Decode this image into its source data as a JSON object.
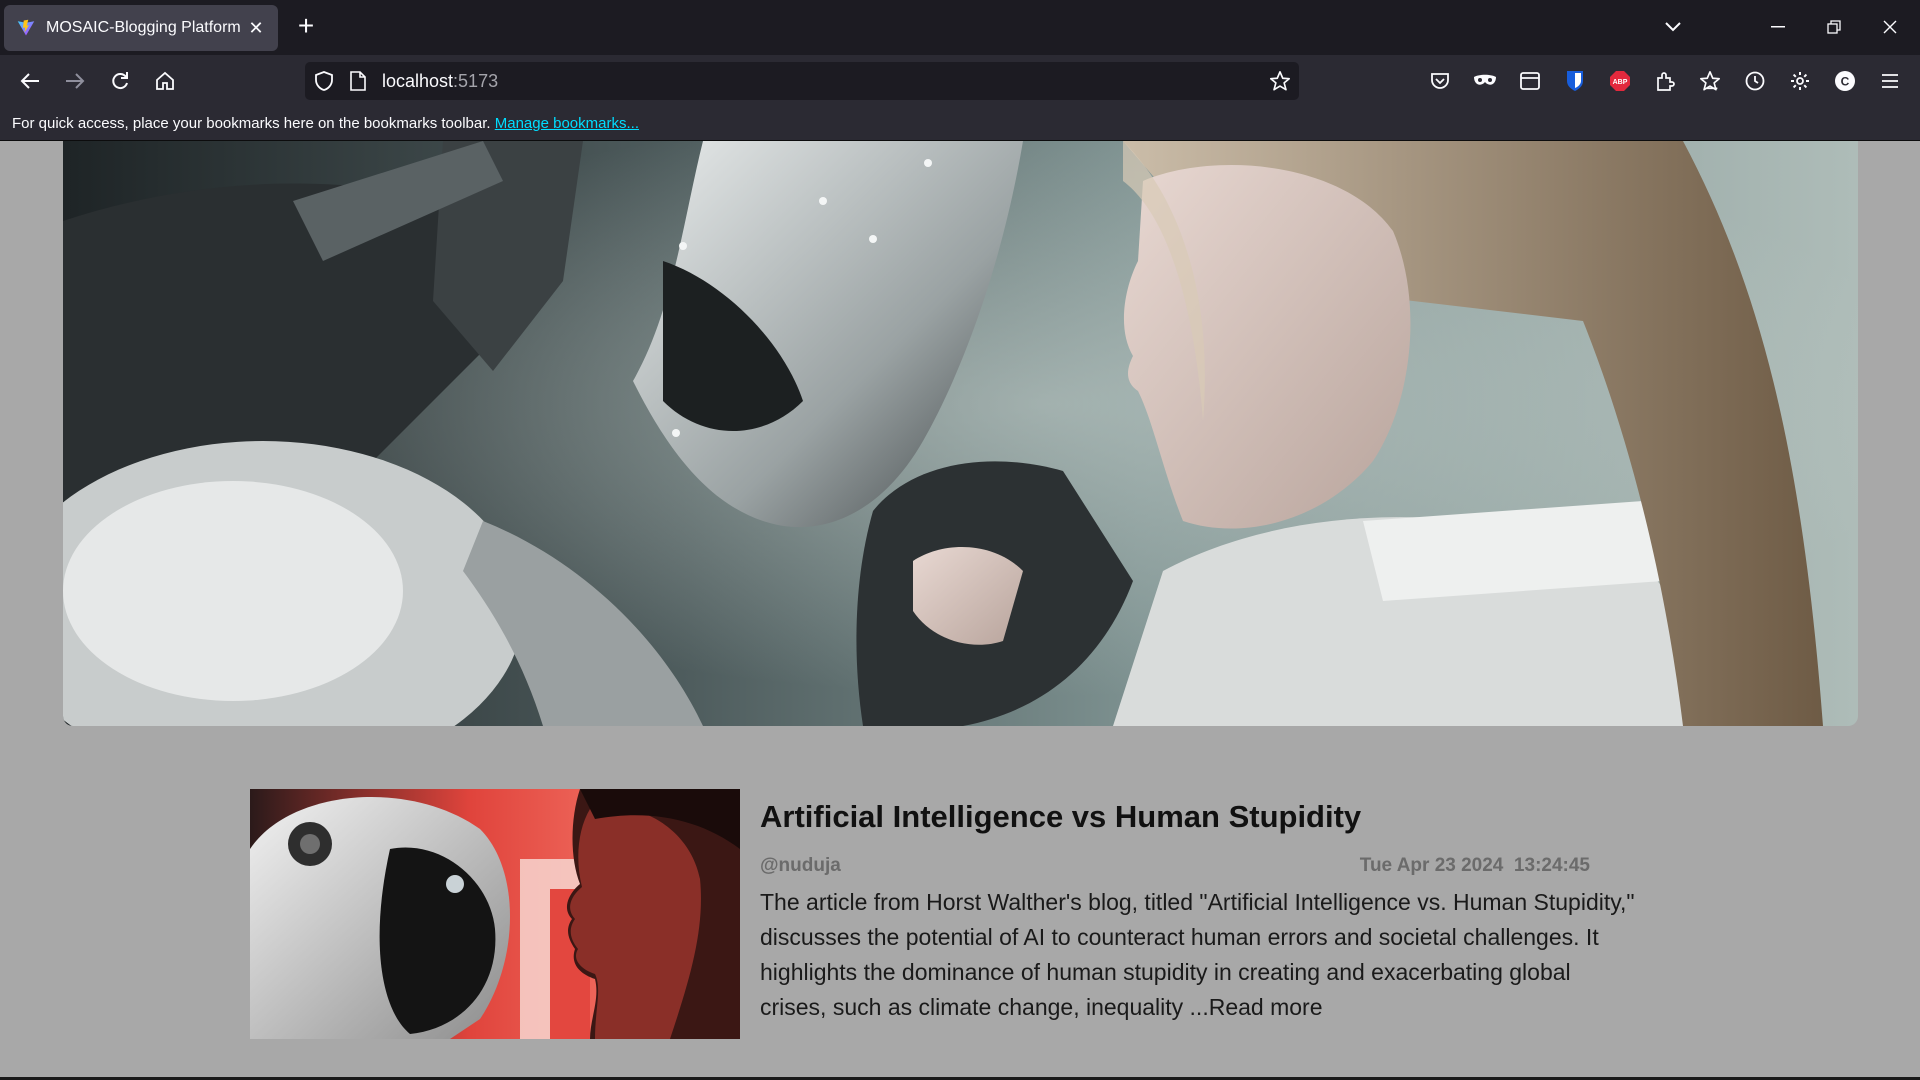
{
  "browser": {
    "tab_title": "MOSAIC-Blogging Platform",
    "url_host": "localhost",
    "url_port": ":5173",
    "bookmarks_message": "For quick access, place your bookmarks here on the bookmarks toolbar.",
    "manage_bookmarks": "Manage bookmarks..."
  },
  "post": {
    "title": "Artificial Intelligence vs Human Stupidity",
    "author": "@nuduja",
    "date": "Tue Apr 23 2024  13:24:45",
    "excerpt": "The article from Horst Walther's blog, titled \"Artificial Intelligence vs. Human Stupidity,\" discusses the potential of AI to counteract human errors and societal challenges. It highlights the dominance of human stupidity in creating and exacerbating global crises, such as climate change, inequality ...",
    "read_more": "Read more"
  },
  "icons": {
    "favicon": "vite-logo-icon",
    "shield": "tracking-shield-icon",
    "page": "page-icon",
    "star": "bookmark-star-icon",
    "pocket": "pocket-icon",
    "mask": "incognito-mask-icon",
    "sidebar": "sidebar-icon",
    "bitwarden": "bitwarden-icon",
    "abp": "adblock-plus-icon",
    "extensions": "extensions-icon",
    "bookmarks": "bookmarks-menu-icon",
    "history": "history-icon",
    "settings": "settings-icon",
    "account": "account-icon",
    "menu": "hamburger-menu-icon"
  },
  "colors": {
    "page_bg": "#a8a8a8",
    "tabbar_bg": "#1c1b22",
    "toolbar_bg": "#2b2a33",
    "link": "#00ddff",
    "abp_red": "#e3293d",
    "bitwarden_blue": "#175ddc"
  }
}
